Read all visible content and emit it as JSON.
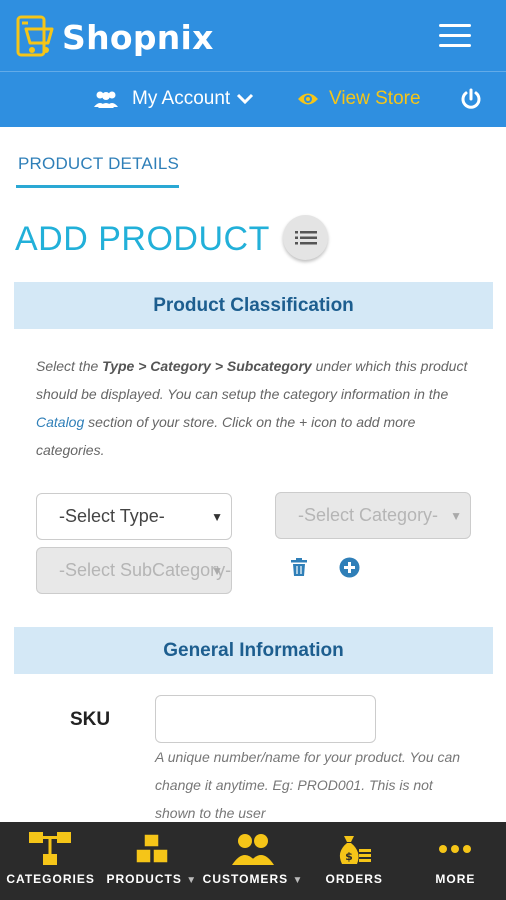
{
  "header": {
    "brand": "Shopnix",
    "account_label": "My Account",
    "view_store_label": "View Store"
  },
  "tabs": {
    "product_details": "PRODUCT DETAILS"
  },
  "page": {
    "title": "ADD PRODUCT"
  },
  "classification": {
    "heading": "Product Classification",
    "desc_1": "Select the ",
    "desc_type": "Type > Category > Subcategory",
    "desc_2": " under which this product should be displayed. You can setup the category information in the ",
    "desc_link": "Catalog",
    "desc_3": " section of your store. Click on the + icon to add more categories.",
    "type_select": "-Select Type-",
    "category_select": "-Select Category-",
    "subcategory_select": "-Select SubCategory-"
  },
  "general": {
    "heading": "General Information",
    "sku_label": "SKU",
    "sku_value": "",
    "sku_help": "A unique number/name for your product. You can change it anytime. Eg: PROD001. This is not shown to the user"
  },
  "bottom_nav": {
    "categories": "CATEGORIES",
    "products": "PRODUCTS",
    "customers": "CUSTOMERS",
    "orders": "ORDERS",
    "more": "MORE"
  },
  "colors": {
    "header_blue": "#2f8fe0",
    "accent_yellow": "#f5c518",
    "title_cyan": "#22b0d9",
    "section_bg": "#d4e8f6",
    "nav_bg": "#2b2b2b"
  }
}
